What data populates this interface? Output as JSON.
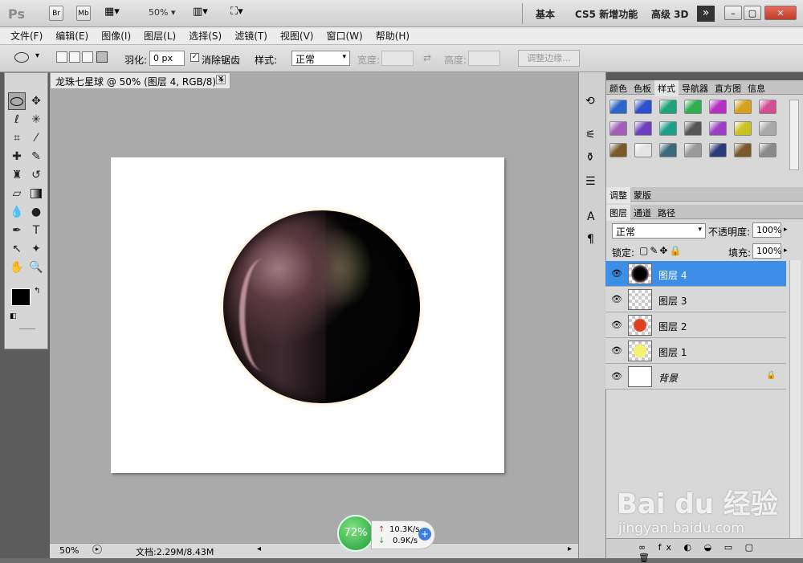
{
  "app": {
    "logo": "Ps",
    "bridge_label": "Br",
    "minibridge_label": "Mb",
    "zoom_value": "50%",
    "workspaces": [
      "基本",
      "CS5 新增功能",
      "高级 3D"
    ],
    "more_label": "»"
  },
  "menu": [
    "文件(F)",
    "编辑(E)",
    "图像(I)",
    "图层(L)",
    "选择(S)",
    "滤镜(T)",
    "视图(V)",
    "窗口(W)",
    "帮助(H)"
  ],
  "options": {
    "feather_label": "羽化:",
    "feather_value": "0 px",
    "antialias_label": "消除锯齿",
    "antialias_checked": true,
    "style_label": "样式:",
    "style_value": "正常",
    "width_label": "宽度:",
    "height_label": "高度:",
    "refine_button": "调整边缘..."
  },
  "document": {
    "tab_title": "龙珠七星球 @ 50% (图层 4, RGB/8) *"
  },
  "status": {
    "zoom": "50%",
    "doc_info": "文档:2.29M/8.43M"
  },
  "net": {
    "percent": "72%",
    "up": "10.3K/s",
    "down": "0.9K/s"
  },
  "panels": {
    "top_tabs": [
      "颜色",
      "色板",
      "样式",
      "导航器",
      "直方图",
      "信息"
    ],
    "active_top_tab": "样式",
    "mid_tabs": [
      "调整",
      "蒙版"
    ],
    "layer_tabs": [
      "图层",
      "通道",
      "路径"
    ],
    "blend_mode": "正常",
    "opacity_label": "不透明度:",
    "opacity_value": "100%",
    "lock_label": "锁定:",
    "fill_label": "填充:",
    "fill_value": "100%",
    "style_swatch_colors": [
      "#2a66c9",
      "#2f4fd0",
      "#1fa37a",
      "#2fb04f",
      "#b52fc1",
      "#d6a21d",
      "#d34d93",
      "#a35fb8",
      "#6d3fbf",
      "#1f9f8a",
      "#555555",
      "#9b3fc6",
      "#c9c21f",
      "#a8a8a8",
      "#7a5a2a",
      "#e4e4e4",
      "#3a6a7a",
      "#9a9a9a",
      "#2c3a7a",
      "#7a5a2a",
      "#8a8a8a"
    ]
  },
  "layers": [
    {
      "name": "图层 4",
      "selected": true,
      "thumb": "ball"
    },
    {
      "name": "图层 3",
      "selected": false,
      "thumb": "empty"
    },
    {
      "name": "图层 2",
      "selected": false,
      "thumb": "red"
    },
    {
      "name": "图层 1",
      "selected": false,
      "thumb": "yellow"
    },
    {
      "name": "背景",
      "selected": false,
      "thumb": "white",
      "locked": true
    }
  ],
  "watermark": {
    "brand": "Bai du 经验",
    "url": "jingyan.baidu.com"
  }
}
